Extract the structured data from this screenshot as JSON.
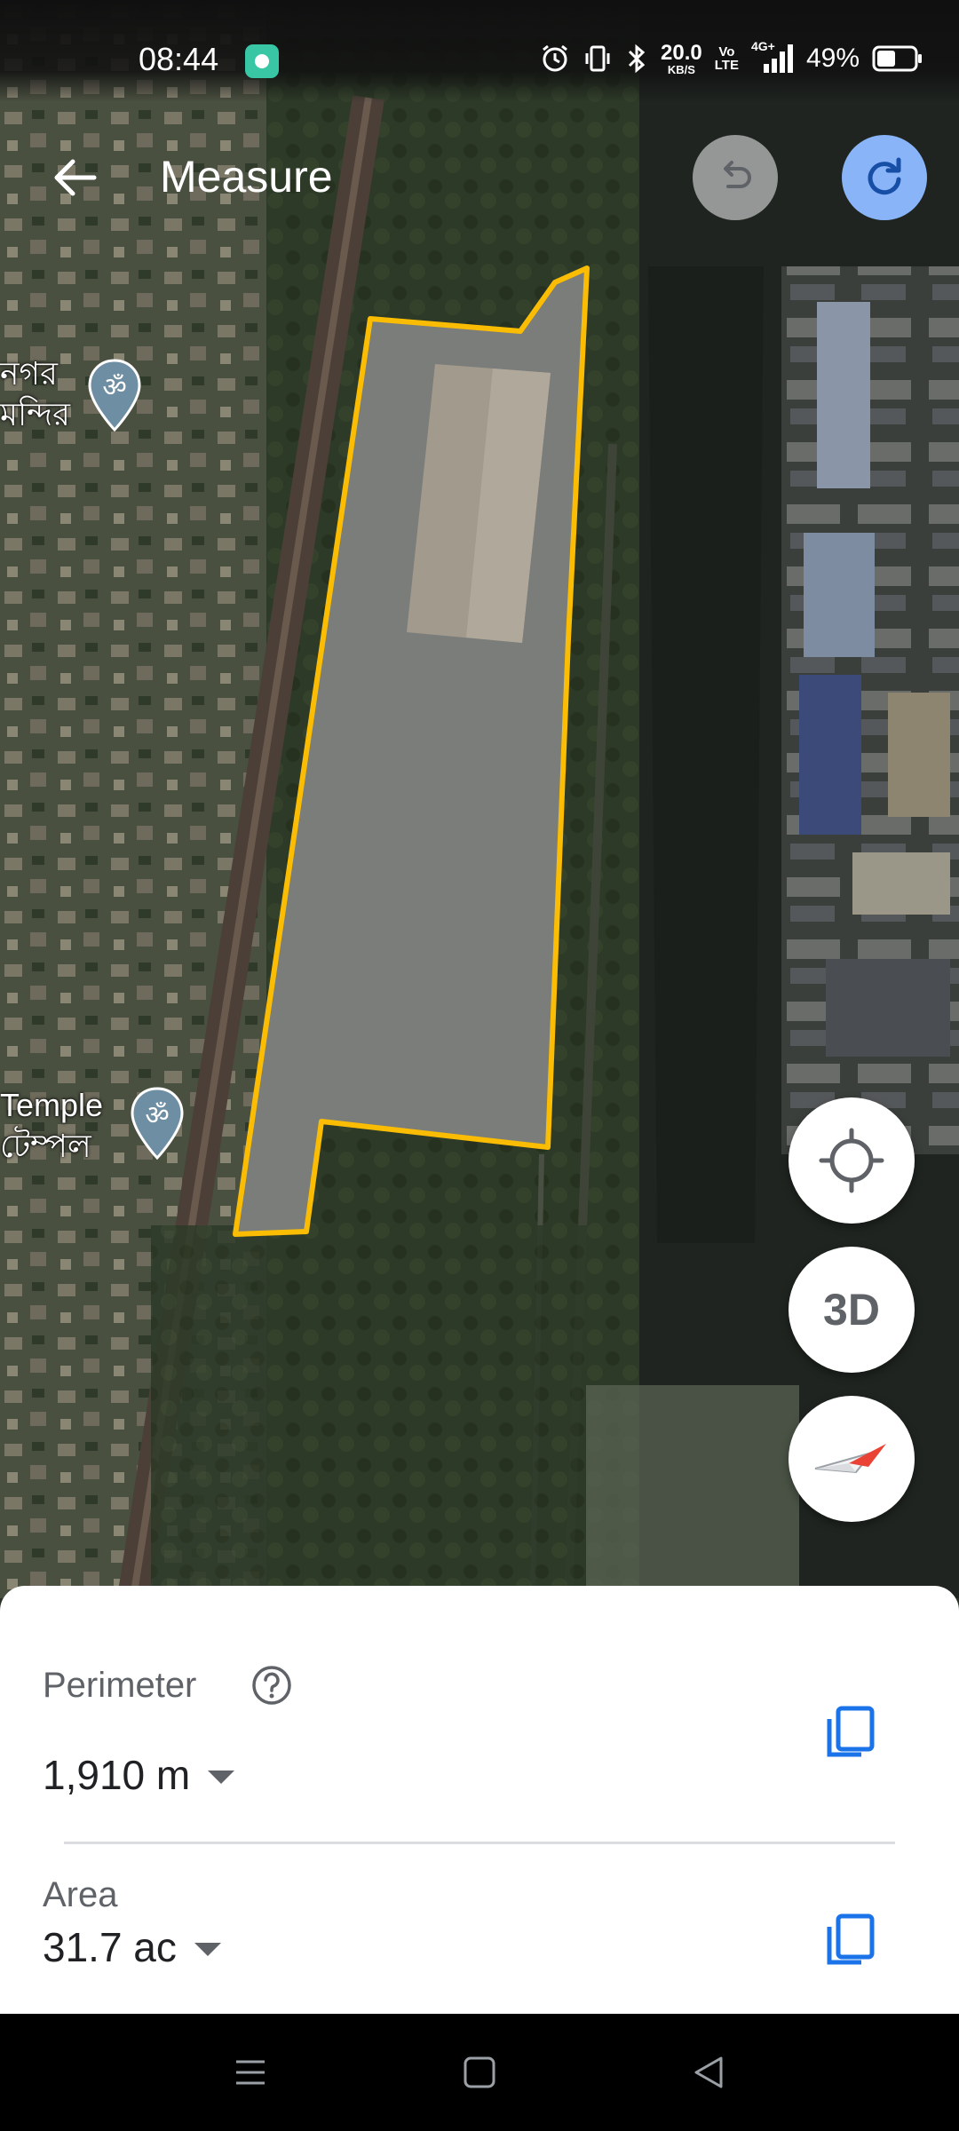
{
  "status_bar": {
    "time": "08:44",
    "net_speed_value": "20.0",
    "net_speed_unit": "KB/S",
    "volte_top": "Vo",
    "volte_bottom": "LTE",
    "network_type": "4G+",
    "battery_percent": "49%",
    "battery_level": 0.49
  },
  "top_bar": {
    "title": "Measure",
    "back_icon": "arrow-back-icon",
    "undo_icon": "undo-icon",
    "redo_icon": "redo-icon"
  },
  "map": {
    "labels": [
      {
        "line1": "নগর",
        "line2": "মন্দির"
      },
      {
        "line1": "Temple",
        "line2": "টেম্পল"
      }
    ],
    "polygon_color": "#fbbc04",
    "poi_icon": "om-temple-pin-icon"
  },
  "fabs": {
    "location_icon": "my-location-icon",
    "three_d_label": "3D",
    "compass_icon": "compass-icon"
  },
  "measurements": {
    "perimeter_label": "Perimeter",
    "perimeter_value": "1,910 m",
    "area_label": "Area",
    "area_value": "31.7 ac",
    "accent_color": "#1a73e8"
  },
  "nav_bar": {
    "menu_icon": "menu-icon",
    "home_icon": "home-square-icon",
    "back_icon": "back-triangle-icon"
  }
}
